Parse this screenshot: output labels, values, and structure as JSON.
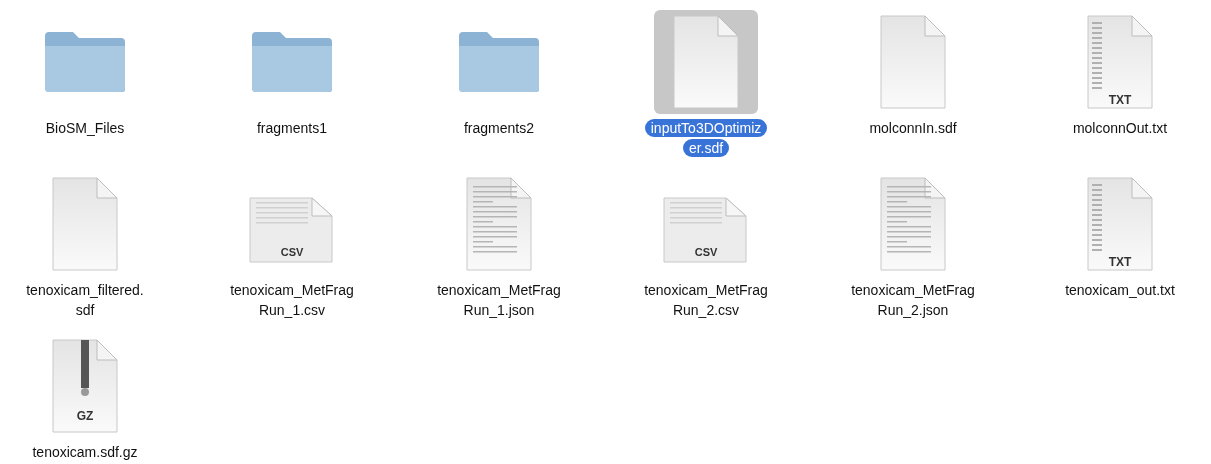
{
  "files": [
    {
      "kind": "folder",
      "lines": [
        "BioSM_Files"
      ],
      "selected": false
    },
    {
      "kind": "folder",
      "lines": [
        "fragments1"
      ],
      "selected": false
    },
    {
      "kind": "folder",
      "lines": [
        "fragments2"
      ],
      "selected": false
    },
    {
      "kind": "blank",
      "lines": [
        "inputTo3DOptimiz",
        "er.sdf"
      ],
      "selected": true
    },
    {
      "kind": "blank",
      "lines": [
        "molconnIn.sdf"
      ],
      "selected": false
    },
    {
      "kind": "table",
      "badge": "TXT",
      "lines": [
        "molconnOut.txt"
      ],
      "selected": false
    },
    {
      "kind": "blank",
      "lines": [
        "tenoxicam_filtered.",
        "sdf"
      ],
      "selected": false
    },
    {
      "kind": "sheet",
      "badge": "CSV",
      "lines": [
        "tenoxicam_MetFrag",
        "Run_1.csv"
      ],
      "selected": false
    },
    {
      "kind": "text",
      "lines": [
        "tenoxicam_MetFrag",
        "Run_1.json"
      ],
      "selected": false
    },
    {
      "kind": "sheet",
      "badge": "CSV",
      "lines": [
        "tenoxicam_MetFrag",
        "Run_2.csv"
      ],
      "selected": false
    },
    {
      "kind": "text",
      "lines": [
        "tenoxicam_MetFrag",
        "Run_2.json"
      ],
      "selected": false
    },
    {
      "kind": "table",
      "badge": "TXT",
      "lines": [
        "tenoxicam_out.txt"
      ],
      "selected": false
    },
    {
      "kind": "zip",
      "badge": "GZ",
      "lines": [
        "tenoxicam.sdf.gz"
      ],
      "selected": false
    }
  ]
}
